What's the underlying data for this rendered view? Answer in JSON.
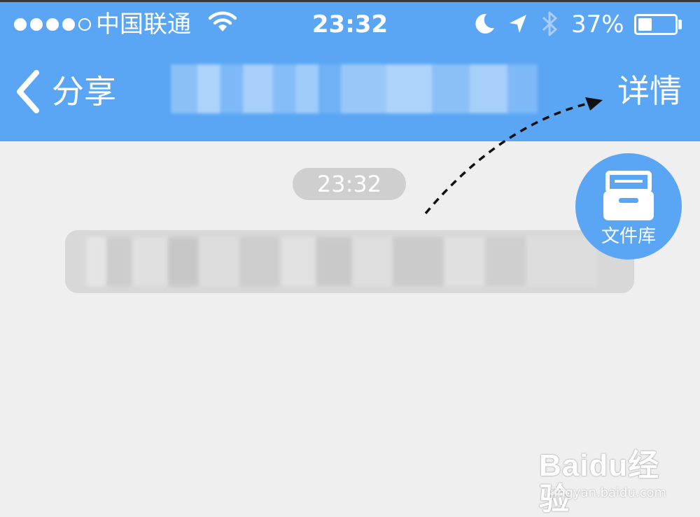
{
  "status_bar": {
    "signal_bars_filled": 4,
    "signal_bars_total": 5,
    "carrier": "中国联通",
    "time": "23:32",
    "battery_percent": "37%",
    "battery_level": 0.37
  },
  "nav_bar": {
    "back_label": "分享",
    "title": "",
    "detail_label": "详情"
  },
  "chat": {
    "timestamp": "23:32",
    "message_text": ""
  },
  "file_library": {
    "label": "文件库"
  },
  "watermark": {
    "logo_text": "Baidu经验",
    "url": "jingyan.baidu.com"
  },
  "colors": {
    "header_blue": "#5aa6f4",
    "background": "#efefef"
  },
  "icons": {
    "signal": "signal-dots-icon",
    "wifi": "wifi-icon",
    "moon": "moon-icon",
    "location": "location-arrow-icon",
    "bluetooth": "bluetooth-icon",
    "battery": "battery-icon",
    "back": "chevron-left-icon",
    "file_library": "file-cabinet-icon"
  }
}
